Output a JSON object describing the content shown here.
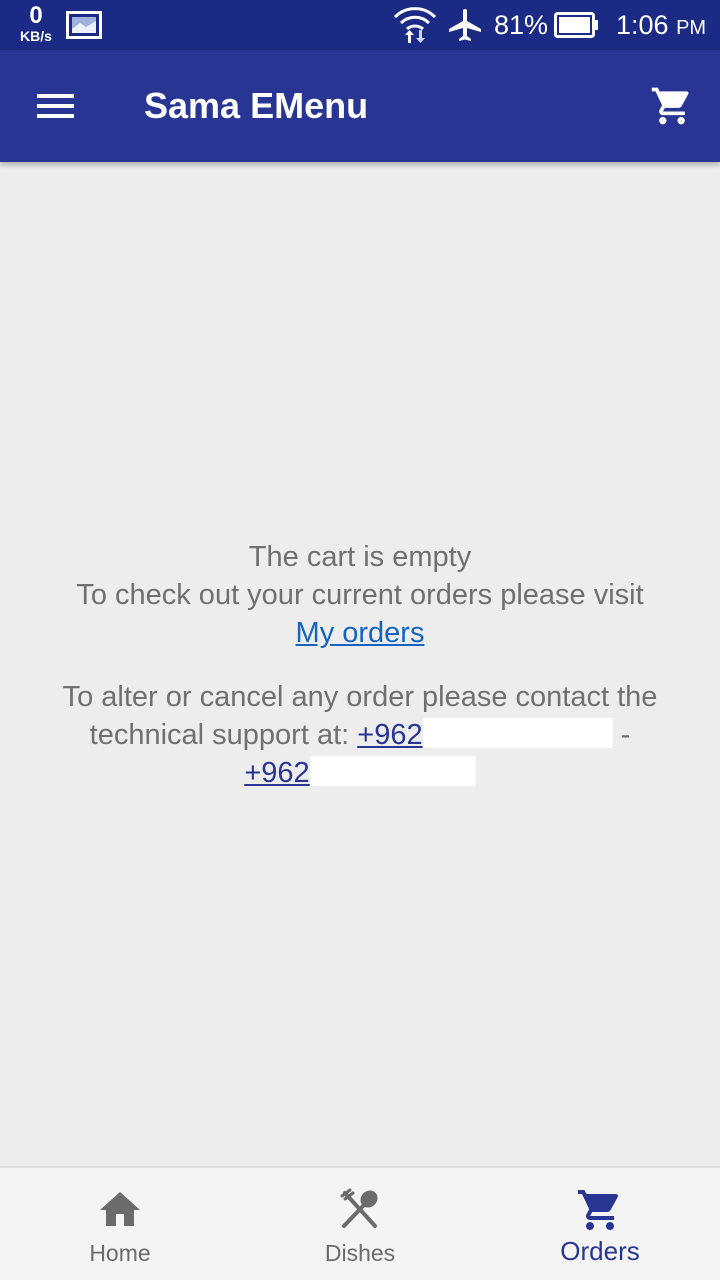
{
  "status_bar": {
    "net_speed_value": "0",
    "net_speed_unit": "KB/s",
    "battery_percent": "81%",
    "time": "1:06",
    "time_suffix": "PM"
  },
  "app_bar": {
    "title": "Sama EMenu",
    "color": "#283593"
  },
  "content": {
    "empty_message": "The cart is empty",
    "orders_prompt": "To check out your current orders please visit",
    "orders_link": "My orders",
    "support_line1": "To alter or cancel any order please contact the",
    "support_line2_prefix": "technical support at:",
    "phone1_visible": "+962",
    "phone_separator": "-",
    "phone2_visible": "+962"
  },
  "bottom_nav": {
    "items": [
      {
        "label": "Home",
        "icon": "home-icon"
      },
      {
        "label": "Dishes",
        "icon": "dishes-icon"
      },
      {
        "label": "Orders",
        "icon": "cart-icon",
        "active": true
      }
    ],
    "active_color": "#283593"
  }
}
